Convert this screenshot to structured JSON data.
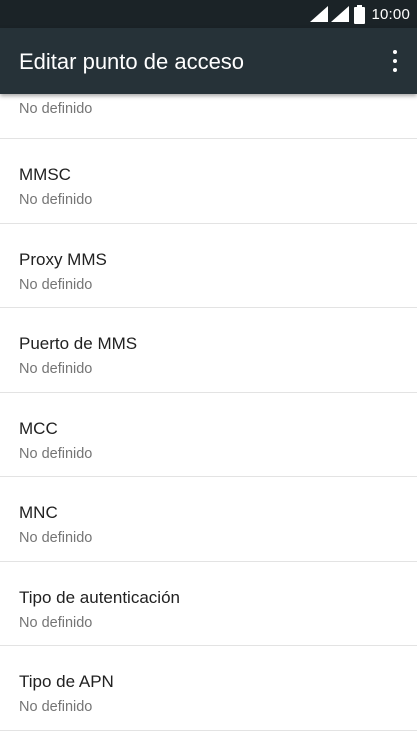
{
  "status_bar": {
    "time": "10:00",
    "icons": [
      "signal-icon",
      "signal-icon",
      "battery-icon"
    ]
  },
  "app_bar": {
    "title": "Editar punto de acceso",
    "menu_icon": "overflow-menu-icon"
  },
  "list": {
    "partial_item": {
      "summary": "No definido"
    },
    "items": [
      {
        "title": "MMSC",
        "summary": "No definido"
      },
      {
        "title": "Proxy MMS",
        "summary": "No definido"
      },
      {
        "title": "Puerto de MMS",
        "summary": "No definido"
      },
      {
        "title": "MCC",
        "summary": "No definido"
      },
      {
        "title": "MNC",
        "summary": "No definido"
      },
      {
        "title": "Tipo de autenticación",
        "summary": "No definido"
      },
      {
        "title": "Tipo de APN",
        "summary": "No definido"
      }
    ]
  },
  "colors": {
    "status_bar": "#1b2327",
    "app_bar": "#263238",
    "title_text": "#212121",
    "summary_text": "#757575",
    "divider": "#e3e3e3"
  }
}
